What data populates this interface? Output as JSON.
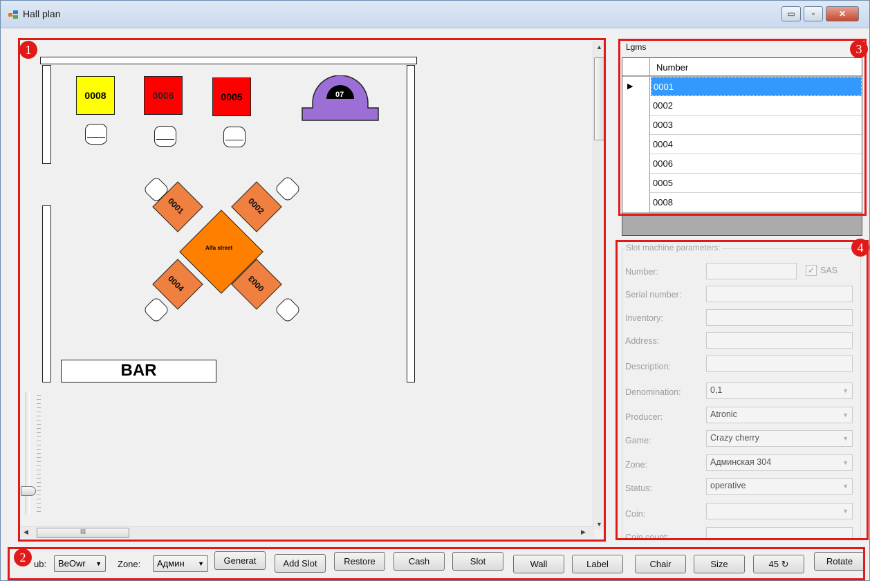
{
  "window": {
    "title": "Hall plan",
    "controls": {
      "minimize": "▭",
      "maximize": "▫",
      "close": "✕"
    }
  },
  "annotations": [
    "1",
    "2",
    "3",
    "4"
  ],
  "hall": {
    "top_slots": [
      {
        "number": "0008",
        "color": "#ffff00"
      },
      {
        "number": "0006",
        "color": "#ff0000"
      },
      {
        "number": "0005",
        "color": "#ff0000"
      }
    ],
    "roulette": {
      "number": "07",
      "color": "#9b6fd6"
    },
    "table": {
      "name": "Alfa street",
      "color": "#ff8000",
      "slots": [
        "0001",
        "0002",
        "0004",
        "0003"
      ],
      "slot_color": "#f08040"
    },
    "bar_label": "BAR",
    "hscroll_grip": "III"
  },
  "lgms": {
    "title": "Lgms",
    "column": "Number",
    "rows": [
      "0001",
      "0002",
      "0003",
      "0004",
      "0006",
      "0005",
      "0008"
    ],
    "selected_index": 0,
    "selection_color": "#3399ff"
  },
  "params": {
    "title": "Slot machine parameters:",
    "number_label": "Number:",
    "sas_label": "SAS",
    "sas_checked": true,
    "serial_label": "Serial number:",
    "inventory_label": "Inventory:",
    "address_label": "Address:",
    "description_label": "Description:",
    "denomination_label": "Denomination:",
    "denomination_value": "0,1",
    "producer_label": "Producer:",
    "producer_value": "Atronic",
    "game_label": "Game:",
    "game_value": "Crazy cherry",
    "zone_label": "Zone:",
    "zone_value": "Админская 304",
    "status_label": "Status:",
    "status_value": "operative",
    "coin_label": "Coin:",
    "coin_count_label": "Coin count:"
  },
  "toolbar": {
    "club_label": "ub:",
    "club_value": "BeOwr",
    "zone_label": "Zone:",
    "zone_value": "Админ",
    "buttons": {
      "generate": "Generat",
      "add_slot": "Add Slot",
      "restore": "Restore",
      "cash": "Cash",
      "slot": "Slot",
      "wall": "Wall",
      "label": "Label",
      "chair": "Chair",
      "size": "Size",
      "angle": "45 ↻",
      "rotate": "Rotate"
    }
  },
  "colors": {
    "annotation": "#e01919",
    "accent": "#3399ff"
  }
}
